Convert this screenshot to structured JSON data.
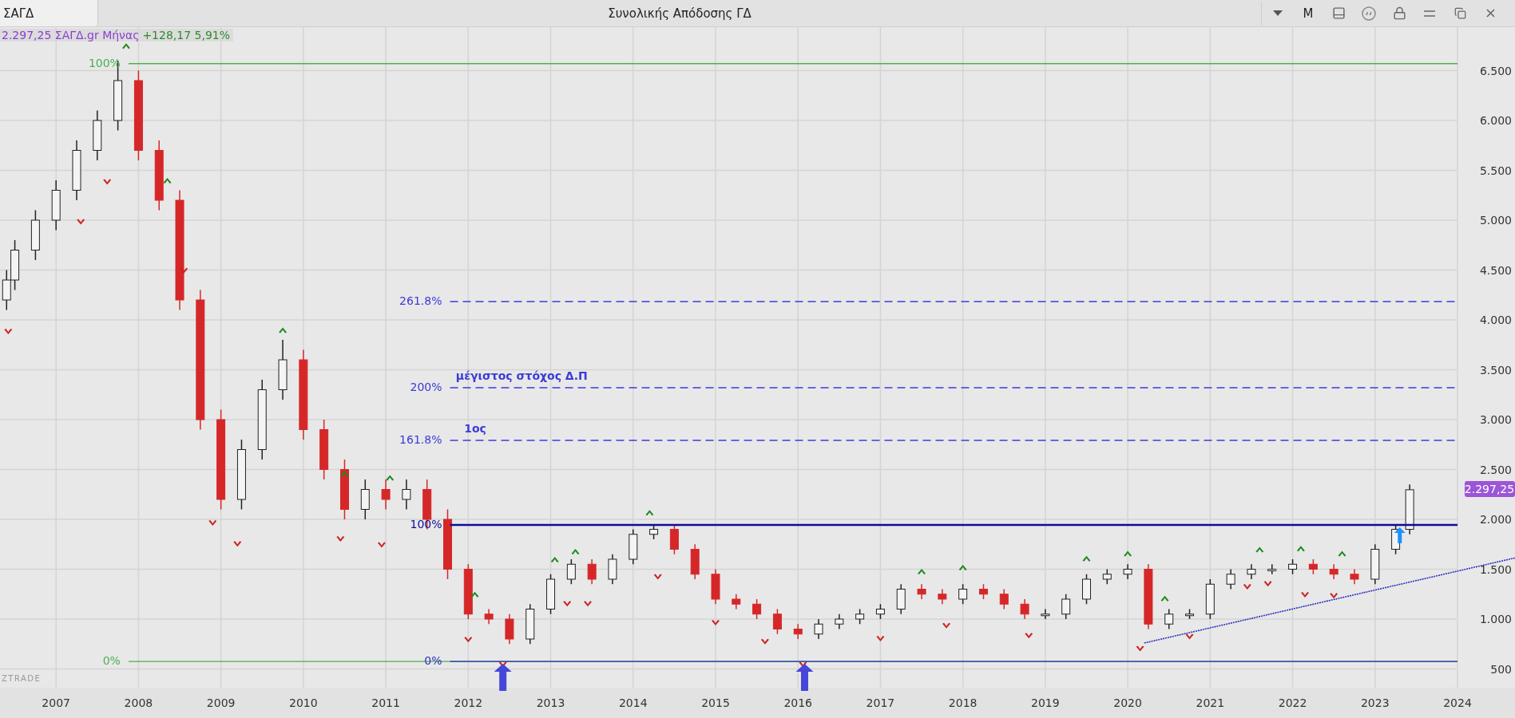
{
  "tab": {
    "label": "ΣΑΓΔ",
    "selected": true
  },
  "window": {
    "title": "Συνολικής Απόδοσης ΓΔ"
  },
  "toolbar": {
    "period": "M"
  },
  "quote": {
    "last": "2.297,25",
    "symbol": "ΣΑΓΔ.gr",
    "period": "Μήνας",
    "change": "+128,17",
    "change_pct": "5,91%"
  },
  "logo": "ZTRADE",
  "chart": {
    "price_badge": "2.297,25",
    "levels": [
      {
        "label": "100%"
      },
      {
        "label": "0%"
      },
      {
        "label": "261.8%"
      },
      {
        "label": "200%"
      },
      {
        "label": "161.8%"
      },
      {
        "label": "100%"
      },
      {
        "label": "0%"
      }
    ],
    "chart_data": {
      "type": "candlestick",
      "grid": true,
      "xlim": [
        2006.32,
        2024
      ],
      "ylim": [
        312,
        6936
      ],
      "xticks": [
        2007,
        2008,
        2009,
        2010,
        2011,
        2012,
        2013,
        2014,
        2015,
        2016,
        2017,
        2018,
        2019,
        2020,
        2021,
        2022,
        2023,
        2024
      ],
      "yticks": [
        {
          "value": 500,
          "label": "500"
        },
        {
          "value": 1000,
          "label": "1.000"
        },
        {
          "value": 1500,
          "label": "1.500"
        },
        {
          "value": 2000,
          "label": "2.000"
        },
        {
          "value": 2500,
          "label": "2.500"
        },
        {
          "value": 3000,
          "label": "3.000"
        },
        {
          "value": 3500,
          "label": "3.500"
        },
        {
          "value": 4000,
          "label": "4.000"
        },
        {
          "value": 4500,
          "label": "4.500"
        },
        {
          "value": 5000,
          "label": "5.000"
        },
        {
          "value": 5500,
          "label": "5.500"
        },
        {
          "value": 6000,
          "label": "6.000"
        },
        {
          "value": 6500,
          "label": "6.500"
        }
      ],
      "x": [
        2006.4,
        2006.5,
        2006.75,
        2007,
        2007.25,
        2007.5,
        2007.75,
        2008,
        2008.25,
        2008.5,
        2008.75,
        2009,
        2009.25,
        2009.5,
        2009.75,
        2010,
        2010.25,
        2010.5,
        2010.75,
        2011,
        2011.25,
        2011.5,
        2011.75,
        2012,
        2012.25,
        2012.5,
        2012.75,
        2013,
        2013.25,
        2013.5,
        2013.75,
        2014,
        2014.25,
        2014.5,
        2014.75,
        2015,
        2015.25,
        2015.5,
        2015.75,
        2016,
        2016.25,
        2016.5,
        2016.75,
        2017,
        2017.25,
        2017.5,
        2017.75,
        2018,
        2018.25,
        2018.5,
        2018.75,
        2019,
        2019.25,
        2019.5,
        2019.75,
        2020,
        2020.25,
        2020.5,
        2020.75,
        2021,
        2021.25,
        2021.5,
        2021.75,
        2022,
        2022.25,
        2022.5,
        2022.75,
        2023,
        2023.25,
        2023.42
      ],
      "ohlc": [
        [
          4200,
          4500,
          4100,
          4400
        ],
        [
          4400,
          4800,
          4300,
          4700
        ],
        [
          4700,
          5100,
          4600,
          5000
        ],
        [
          5000,
          5400,
          4900,
          5300
        ],
        [
          5300,
          5800,
          5200,
          5700
        ],
        [
          5700,
          6100,
          5600,
          6000
        ],
        [
          6000,
          6600,
          5900,
          6400
        ],
        [
          6400,
          6500,
          5600,
          5700
        ],
        [
          5700,
          5800,
          5100,
          5200
        ],
        [
          5200,
          5300,
          4100,
          4200
        ],
        [
          4200,
          4300,
          2900,
          3000
        ],
        [
          3000,
          3100,
          2100,
          2200
        ],
        [
          2200,
          2800,
          2100,
          2700
        ],
        [
          2700,
          3400,
          2600,
          3300
        ],
        [
          3300,
          3800,
          3200,
          3600
        ],
        [
          3600,
          3700,
          2800,
          2900
        ],
        [
          2900,
          3000,
          2400,
          2500
        ],
        [
          2500,
          2600,
          2000,
          2100
        ],
        [
          2100,
          2400,
          2000,
          2300
        ],
        [
          2300,
          2400,
          2100,
          2200
        ],
        [
          2200,
          2400,
          2100,
          2300
        ],
        [
          2300,
          2400,
          1900,
          2000
        ],
        [
          2000,
          2100,
          1400,
          1500
        ],
        [
          1500,
          1550,
          1000,
          1050
        ],
        [
          1050,
          1100,
          950,
          1000
        ],
        [
          1000,
          1050,
          750,
          800
        ],
        [
          800,
          1150,
          750,
          1100
        ],
        [
          1100,
          1450,
          1050,
          1400
        ],
        [
          1400,
          1600,
          1350,
          1550
        ],
        [
          1550,
          1600,
          1350,
          1400
        ],
        [
          1400,
          1650,
          1350,
          1600
        ],
        [
          1600,
          1900,
          1550,
          1850
        ],
        [
          1850,
          1950,
          1800,
          1900
        ],
        [
          1900,
          1950,
          1650,
          1700
        ],
        [
          1700,
          1750,
          1400,
          1450
        ],
        [
          1450,
          1500,
          1150,
          1200
        ],
        [
          1200,
          1250,
          1100,
          1150
        ],
        [
          1150,
          1200,
          1000,
          1050
        ],
        [
          1050,
          1100,
          850,
          900
        ],
        [
          900,
          950,
          800,
          850
        ],
        [
          850,
          1000,
          800,
          950
        ],
        [
          950,
          1050,
          900,
          1000
        ],
        [
          1000,
          1100,
          950,
          1050
        ],
        [
          1050,
          1150,
          1000,
          1100
        ],
        [
          1100,
          1350,
          1050,
          1300
        ],
        [
          1300,
          1350,
          1200,
          1250
        ],
        [
          1250,
          1300,
          1150,
          1200
        ],
        [
          1200,
          1350,
          1150,
          1300
        ],
        [
          1300,
          1350,
          1200,
          1250
        ],
        [
          1250,
          1300,
          1100,
          1150
        ],
        [
          1150,
          1200,
          1000,
          1050
        ],
        [
          1050,
          1100,
          1000,
          1050
        ],
        [
          1050,
          1250,
          1000,
          1200
        ],
        [
          1200,
          1450,
          1150,
          1400
        ],
        [
          1400,
          1500,
          1350,
          1450
        ],
        [
          1450,
          1550,
          1400,
          1500
        ],
        [
          1500,
          1550,
          900,
          950
        ],
        [
          950,
          1100,
          900,
          1050
        ],
        [
          1050,
          1100,
          1000,
          1050
        ],
        [
          1050,
          1400,
          1000,
          1350
        ],
        [
          1350,
          1500,
          1300,
          1450
        ],
        [
          1450,
          1550,
          1400,
          1500
        ],
        [
          1500,
          1550,
          1450,
          1500
        ],
        [
          1500,
          1600,
          1450,
          1550
        ],
        [
          1550,
          1600,
          1450,
          1500
        ],
        [
          1500,
          1550,
          1400,
          1450
        ],
        [
          1450,
          1500,
          1350,
          1400
        ],
        [
          1400,
          1750,
          1350,
          1700
        ],
        [
          1700,
          1950,
          1650,
          1900
        ],
        [
          1900,
          2350,
          1850,
          2297
        ]
      ],
      "annotations": [
        "μέγιστος στόχος Δ.Π",
        "1ος"
      ]
    }
  }
}
